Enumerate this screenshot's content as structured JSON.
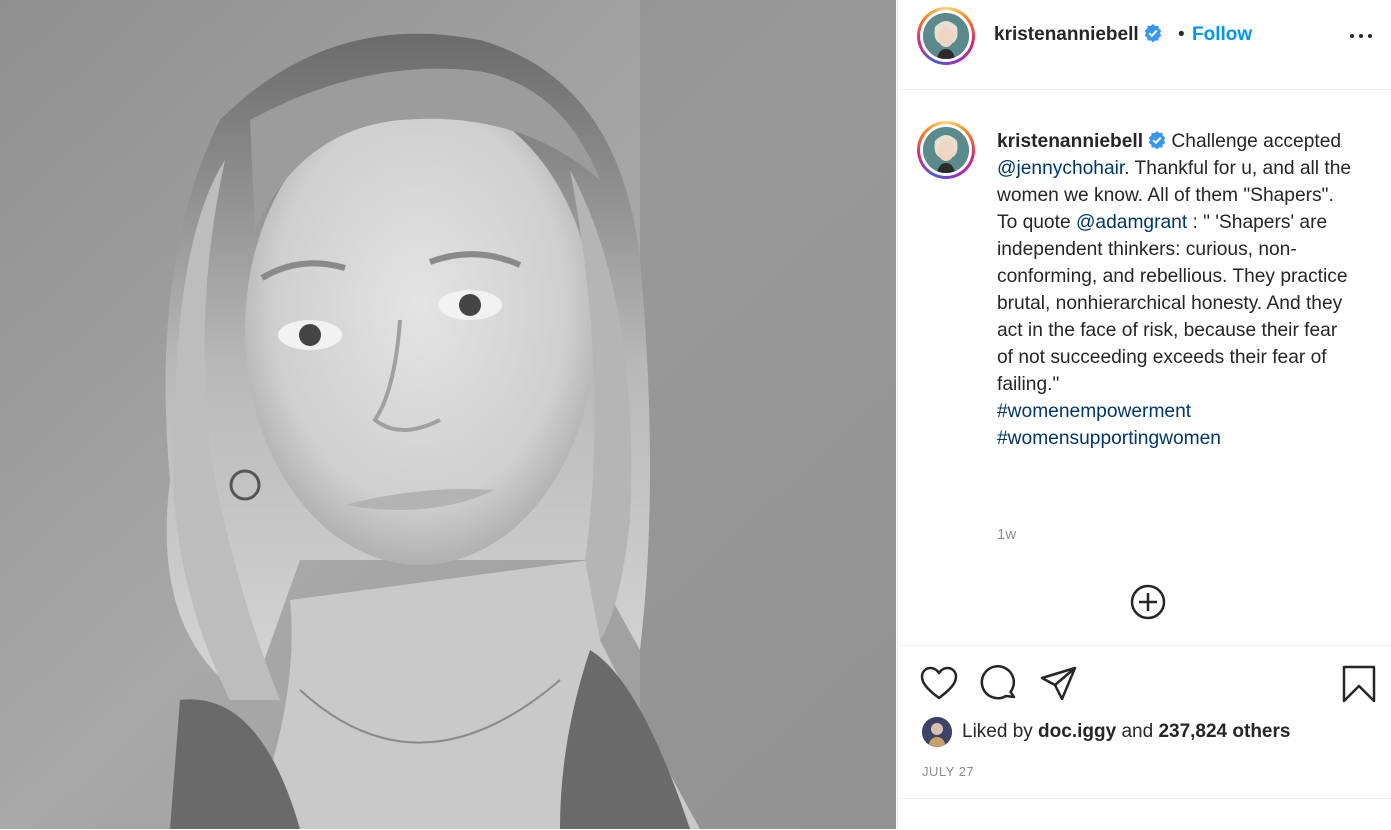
{
  "header": {
    "username": "kristenanniebell",
    "separator": "•",
    "follow_label": "Follow"
  },
  "caption": {
    "username": "kristenanniebell",
    "text_1": " Challenge accepted ",
    "mention_1": "@jennychohair",
    "text_2": ". Thankful for u, and all the women we know. All of them \"Shapers\". To quote ",
    "mention_2": "@adamgrant",
    "text_3": " : \" 'Shapers' are independent thinkers: curious, non-conforming, and rebellious. They practice brutal, nonhierarchical honesty. And they act in the face of risk, because their fear of not succeeding exceeds their fear of failing.\"",
    "hashtag_1": "#womenempowerment",
    "hashtag_2": "#womensupportingwomen",
    "timestamp": "1w"
  },
  "likes": {
    "prefix": "Liked by ",
    "liker": "doc.iggy",
    "middle": " and ",
    "count_text": "237,824 others"
  },
  "date": "JULY 27",
  "colors": {
    "follow_blue": "#0095f6",
    "link_blue": "#00376b",
    "verified_blue": "#3897f0",
    "muted_gray": "#8e8e8e"
  },
  "icons": [
    "verified-badge-icon",
    "more-options-icon",
    "add-comment-icon",
    "heart-icon",
    "comment-icon",
    "share-icon",
    "bookmark-icon"
  ]
}
